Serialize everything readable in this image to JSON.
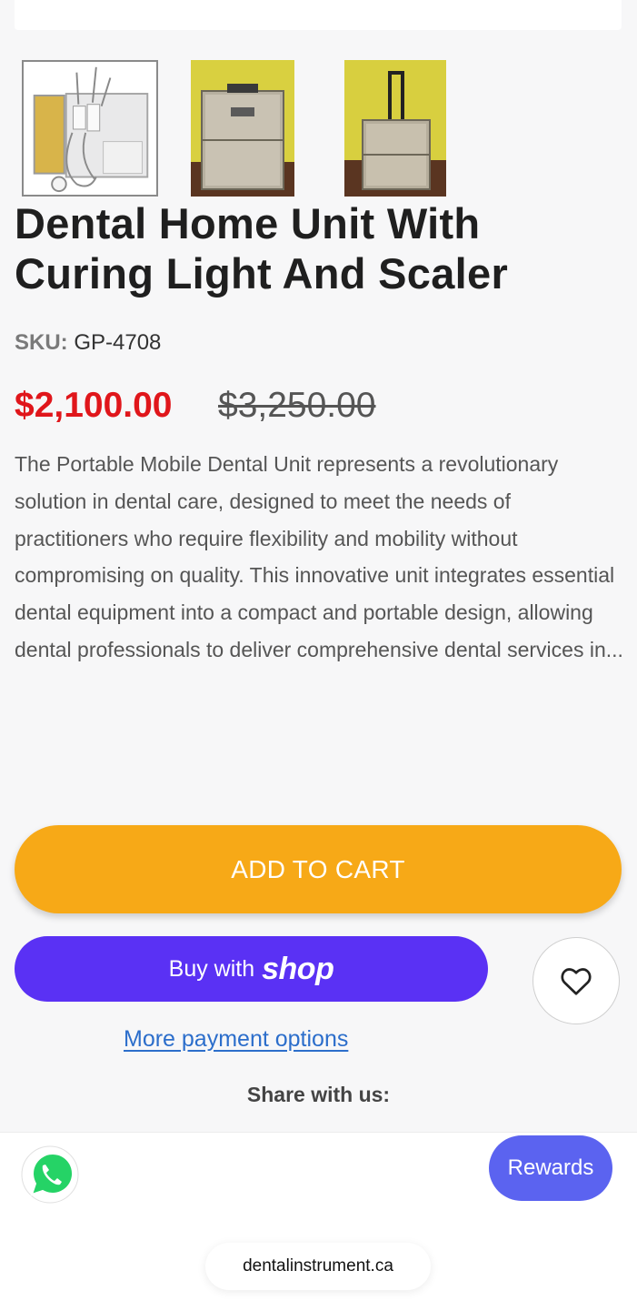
{
  "product": {
    "title": "Dental Home Unit With Curing Light And Scaler",
    "sku_label": "SKU:",
    "sku_value": "GP-4708",
    "sale_price": "$2,100.00",
    "original_price": "$3,250.00",
    "description": "The Portable Mobile Dental Unit represents a revolutionary solution in dental care, designed to meet the needs of practitioners who require flexibility and mobility without compromising on quality. This innovative unit integrates essential dental equipment into a compact and portable design, allowing dental professionals to deliver comprehensive dental services in..."
  },
  "gallery": {
    "thumbnails": [
      {
        "icon": "dental-unit-open-case-image",
        "selected": true
      },
      {
        "icon": "closed-case-front-image",
        "selected": false
      },
      {
        "icon": "case-with-handle-image",
        "selected": false
      }
    ]
  },
  "actions": {
    "add_to_cart": "ADD TO CART",
    "buy_with": "Buy with",
    "shop_logo": "shop",
    "more_payment": "More payment options",
    "share_label": "Share with us:",
    "wishlist_icon": "heart-icon"
  },
  "widgets": {
    "whatsapp_icon": "whatsapp-icon",
    "rewards_label": "Rewards",
    "domain": "dentalinstrument.ca"
  },
  "colors": {
    "sale": "#e0161b",
    "add_to_cart": "#f7a917",
    "shop_pay": "#5a31f4",
    "rewards": "#5b63f0",
    "link": "#2c6ecb"
  }
}
